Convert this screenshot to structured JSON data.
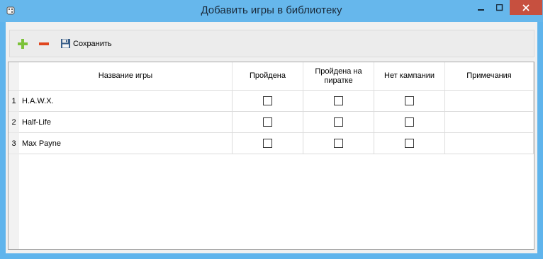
{
  "window": {
    "title": "Добавить игры в библиотеку",
    "controls": {
      "minimize": "—",
      "maximize": "☐",
      "close": "✕"
    }
  },
  "toolbar": {
    "add_icon": "plus-icon",
    "remove_icon": "minus-icon",
    "save_icon": "floppy-disk-icon",
    "save_label": "Сохранить",
    "colors": {
      "add": "#7cc23a",
      "remove": "#e0461e"
    }
  },
  "grid": {
    "columns": [
      {
        "key": "name",
        "label": "Название игры"
      },
      {
        "key": "done",
        "label": "Пройдена"
      },
      {
        "key": "pirate",
        "label": "Пройдена на пиратке"
      },
      {
        "key": "nocamp",
        "label": "Нет кампании"
      },
      {
        "key": "notes",
        "label": "Примечания"
      }
    ],
    "rows": [
      {
        "num": "1",
        "name": "H.A.W.X.",
        "done": false,
        "pirate": false,
        "nocamp": false,
        "notes": ""
      },
      {
        "num": "2",
        "name": "Half-Life",
        "done": false,
        "pirate": false,
        "nocamp": false,
        "notes": ""
      },
      {
        "num": "3",
        "name": "Max Payne",
        "done": false,
        "pirate": false,
        "nocamp": false,
        "notes": ""
      }
    ]
  }
}
